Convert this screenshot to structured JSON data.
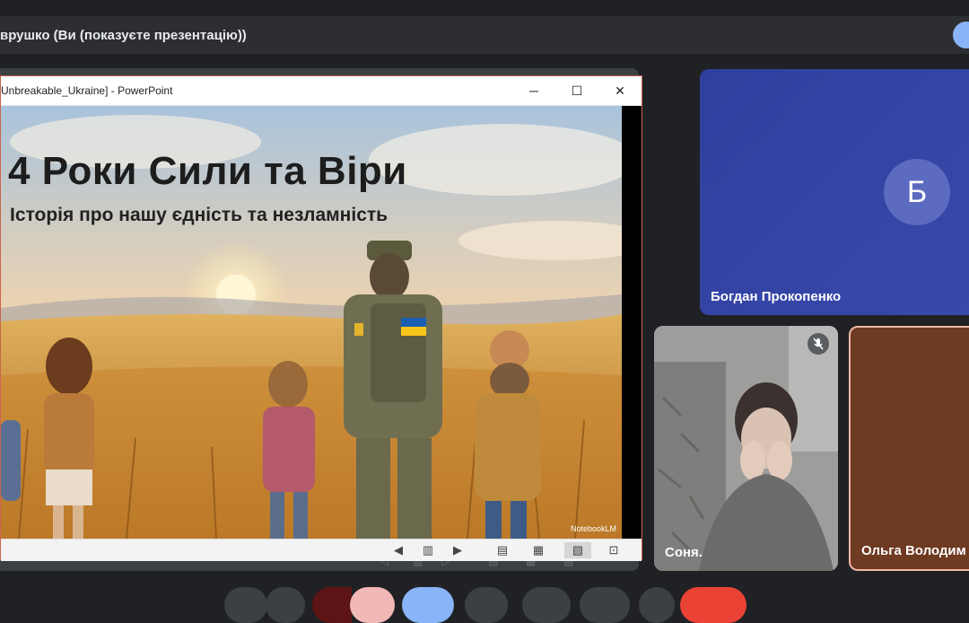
{
  "meeting": {
    "presenter_title": "врушко (Ви (показуєте презентацію))"
  },
  "powerpoint": {
    "window_title": "Unbreakable_Ukraine] - PowerPoint",
    "buttons": {
      "minimize": "─",
      "maximize": "☐",
      "close": "✕"
    },
    "slide": {
      "title": "4 Роки Сили та Віри",
      "subtitle": "Історія про нашу єдність та незламність",
      "watermark": "NotebookLM"
    },
    "status_icons": [
      "prev-slide-icon",
      "slide-counter-icon",
      "next-slide-icon",
      "normal-view-icon",
      "slide-sorter-icon",
      "reading-view-icon",
      "slideshow-icon"
    ]
  },
  "participants": [
    {
      "name": "Богдан Прокопенко",
      "avatar_letter": "Б",
      "muted": false,
      "color": "#3949ab"
    },
    {
      "name": "Соня.",
      "muted": true
    },
    {
      "name": "Ольга Володим",
      "muted": false
    }
  ],
  "controls": {
    "leave_color": "#ea4335",
    "present_color": "#8ab4f8"
  }
}
